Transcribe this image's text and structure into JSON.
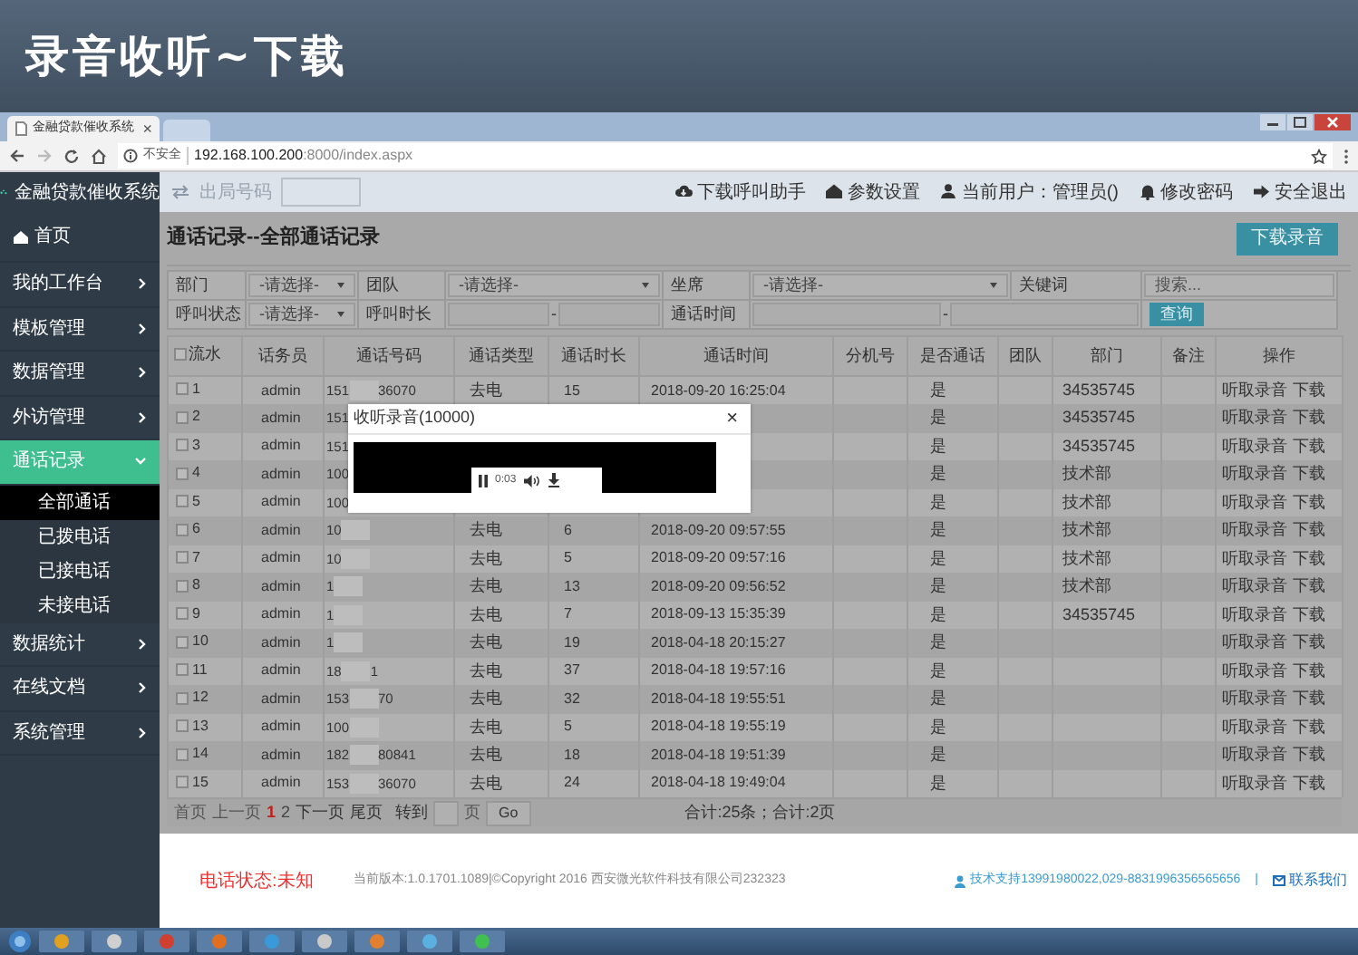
{
  "banner": {
    "title": "录音收听~下载"
  },
  "browser": {
    "tab": {
      "title": "金融贷款催收系统",
      "close": "×"
    },
    "security": "不安全",
    "url_host": "192.168.100.200",
    "url_rest": ":8000/index.aspx"
  },
  "sidebar": {
    "logo": "金融贷款催收系统",
    "items": [
      {
        "label": "首页",
        "kind": "home",
        "selected": false
      },
      {
        "label": "我的工作台",
        "kind": "menu",
        "selected": false,
        "expanded": false
      },
      {
        "label": "模板管理",
        "kind": "menu",
        "selected": false,
        "expanded": false
      },
      {
        "label": "数据管理",
        "kind": "menu",
        "selected": false,
        "expanded": false
      },
      {
        "label": "外访管理",
        "kind": "menu",
        "selected": false,
        "expanded": false
      },
      {
        "label": "通话记录",
        "kind": "menu",
        "selected": true,
        "expanded": true,
        "children": [
          {
            "label": "全部通话",
            "selected": true
          },
          {
            "label": "已拨电话",
            "selected": false
          },
          {
            "label": "已接电话",
            "selected": false
          },
          {
            "label": "未接电话",
            "selected": false
          }
        ]
      },
      {
        "label": "数据统计",
        "kind": "menu",
        "selected": false,
        "expanded": false
      },
      {
        "label": "在线文档",
        "kind": "menu",
        "selected": false,
        "expanded": false
      },
      {
        "label": "系统管理",
        "kind": "menu",
        "selected": false,
        "expanded": false
      }
    ]
  },
  "topbar": {
    "trunk_label": "出局号码",
    "links": [
      {
        "label": "下载呼叫助手",
        "kind": "cloud"
      },
      {
        "label": "参数设置",
        "kind": "home"
      },
      {
        "label": "当前用户：管理员()",
        "kind": "user"
      },
      {
        "label": "修改密码",
        "kind": "bell"
      },
      {
        "label": "安全退出",
        "kind": "exit"
      }
    ]
  },
  "page": {
    "title": "通话记录--全部通话记录",
    "download_button": "下载录音"
  },
  "filter_rows": [
    [
      {
        "label": "部门",
        "kind": "select",
        "value": "-请选择-"
      },
      {
        "label": "团队",
        "kind": "select",
        "value": "-请选择-"
      },
      {
        "label": "坐席",
        "kind": "select",
        "value": "-请选择-"
      },
      {
        "label": "关键词",
        "kind": "text",
        "placeholder": "搜索..."
      }
    ],
    [
      {
        "label": "呼叫状态",
        "kind": "select",
        "value": "-请选择-"
      },
      {
        "label": "呼叫时长",
        "kind": "range",
        "separator": "-"
      },
      {
        "label": "通话时间",
        "kind": "range",
        "separator": "-"
      },
      {
        "kind": "button",
        "label": "查询"
      }
    ]
  ],
  "table": {
    "all_checked": false,
    "columns": [
      "流水",
      "话务员",
      "通话号码",
      "通话类型",
      "通话时长",
      "通话时间",
      "分机号",
      "是否通话",
      "团队",
      "部门",
      "备注",
      "操作"
    ],
    "rows": [
      {
        "no": "1",
        "checked": false,
        "operator": "admin",
        "phone": [
          "151",
          "36070"
        ],
        "type": "去电",
        "duration": "15",
        "time": "2018-09-20 16:25:04",
        "answered": "是",
        "dept": "34535745",
        "actions": [
          "听取录音",
          "下载"
        ]
      },
      {
        "no": "2",
        "checked": false,
        "operator": "admin",
        "phone": [
          "151"
        ],
        "answered": "是",
        "dept": "34535745",
        "actions": [
          "听取录音",
          "下载"
        ]
      },
      {
        "no": "3",
        "checked": false,
        "operator": "admin",
        "phone": [
          "151"
        ],
        "answered": "是",
        "dept": "34535745",
        "actions": [
          "听取录音",
          "下载"
        ]
      },
      {
        "no": "4",
        "checked": false,
        "operator": "admin",
        "phone": [
          "100"
        ],
        "answered": "是",
        "dept": "技术部",
        "actions": [
          "听取录音",
          "下载"
        ]
      },
      {
        "no": "5",
        "checked": false,
        "operator": "admin",
        "phone": [
          "100"
        ],
        "answered": "是",
        "dept": "技术部",
        "actions": [
          "听取录音",
          "下载"
        ]
      },
      {
        "no": "6",
        "checked": false,
        "operator": "admin",
        "phone": [
          "10"
        ],
        "type": "去电",
        "duration": "6",
        "time": "2018-09-20 09:57:55",
        "answered": "是",
        "dept": "技术部",
        "actions": [
          "听取录音",
          "下载"
        ]
      },
      {
        "no": "7",
        "checked": false,
        "operator": "admin",
        "phone": [
          "10"
        ],
        "type": "去电",
        "duration": "5",
        "time": "2018-09-20 09:57:16",
        "answered": "是",
        "dept": "技术部",
        "actions": [
          "听取录音",
          "下载"
        ]
      },
      {
        "no": "8",
        "checked": false,
        "operator": "admin",
        "phone": [
          "1"
        ],
        "type": "去电",
        "duration": "13",
        "time": "2018-09-20 09:56:52",
        "answered": "是",
        "dept": "技术部",
        "actions": [
          "听取录音",
          "下载"
        ]
      },
      {
        "no": "9",
        "checked": false,
        "operator": "admin",
        "phone": [
          "1"
        ],
        "type": "去电",
        "duration": "7",
        "time": "2018-09-13 15:35:39",
        "answered": "是",
        "dept": "34535745",
        "actions": [
          "听取录音",
          "下载"
        ]
      },
      {
        "no": "10",
        "checked": false,
        "operator": "admin",
        "phone": [
          "1"
        ],
        "type": "去电",
        "duration": "19",
        "time": "2018-04-18 20:15:27",
        "answered": "是",
        "actions": [
          "听取录音",
          "下载"
        ]
      },
      {
        "no": "11",
        "checked": false,
        "operator": "admin",
        "phone": [
          "18",
          "1"
        ],
        "type": "去电",
        "duration": "37",
        "time": "2018-04-18 19:57:16",
        "answered": "是",
        "actions": [
          "听取录音",
          "下载"
        ]
      },
      {
        "no": "12",
        "checked": false,
        "operator": "admin",
        "phone": [
          "153",
          "70"
        ],
        "type": "去电",
        "duration": "32",
        "time": "2018-04-18 19:55:51",
        "answered": "是",
        "actions": [
          "听取录音",
          "下载"
        ]
      },
      {
        "no": "13",
        "checked": false,
        "operator": "admin",
        "phone": [
          "100"
        ],
        "type": "去电",
        "duration": "5",
        "time": "2018-04-18 19:55:19",
        "answered": "是",
        "actions": [
          "听取录音",
          "下载"
        ]
      },
      {
        "no": "14",
        "checked": false,
        "operator": "admin",
        "phone": [
          "182",
          "80841"
        ],
        "type": "去电",
        "duration": "18",
        "time": "2018-04-18 19:51:39",
        "answered": "是",
        "actions": [
          "听取录音",
          "下载"
        ]
      },
      {
        "no": "15",
        "checked": false,
        "operator": "admin",
        "phone": [
          "153",
          "36070"
        ],
        "type": "去电",
        "duration": "24",
        "time": "2018-04-18 19:49:04",
        "answered": "是",
        "actions": [
          "听取录音",
          "下载"
        ]
      }
    ]
  },
  "pager": {
    "first": "首页",
    "prev": "上一页",
    "pages": [
      {
        "label": "1",
        "selected": true
      },
      {
        "label": "2",
        "selected": false
      }
    ],
    "next": "下一页",
    "last": "尾页",
    "goto": "转到",
    "unit": "页",
    "go": "Go",
    "summary": "合计:25条；合计:2页"
  },
  "dialog": {
    "title": "收听录音(10000)",
    "close": "×",
    "player": {
      "playing": true,
      "time": "0:03"
    }
  },
  "footer": {
    "phone_status": "电话状态:未知",
    "copyright": "当前版本:1.0.1701.1089|©Copyright 2016 西安微光软件科技有限公司232323",
    "support": "技术支持13991980022,029-8831996356565656",
    "separator": "|",
    "contact": "联系我们"
  }
}
